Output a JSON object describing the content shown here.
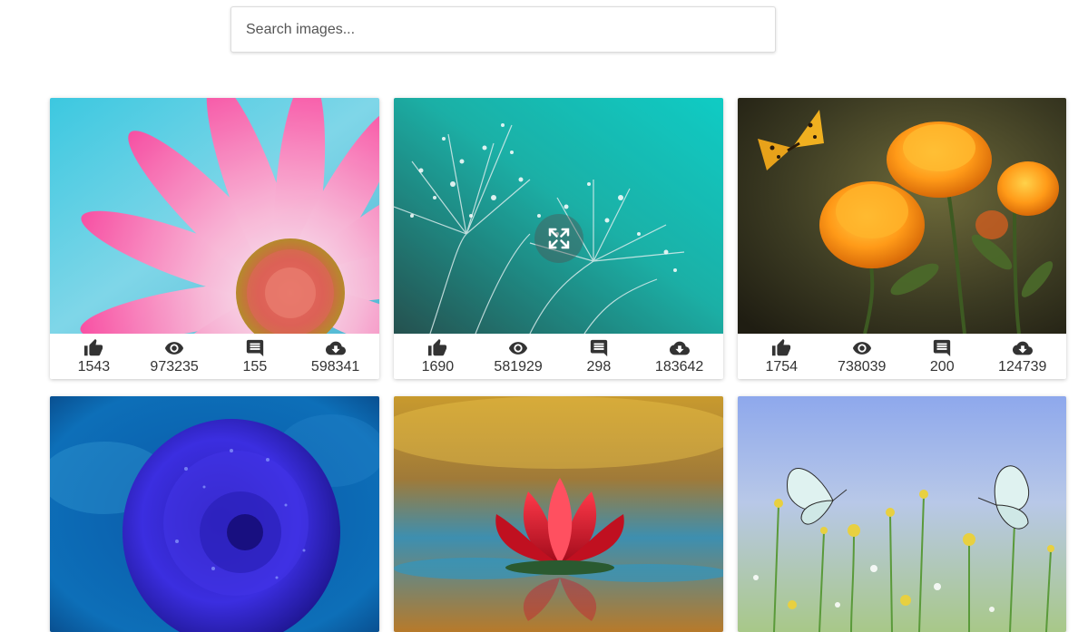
{
  "search": {
    "placeholder": "Search images..."
  },
  "images": [
    {
      "likes": "1543",
      "views": "973235",
      "comments": "155",
      "downloads": "598341"
    },
    {
      "likes": "1690",
      "views": "581929",
      "comments": "298",
      "downloads": "183642"
    },
    {
      "likes": "1754",
      "views": "738039",
      "comments": "200",
      "downloads": "124739"
    }
  ],
  "icons": {
    "likes": "thumbs-up-icon",
    "views": "eye-icon",
    "comments": "comment-icon",
    "downloads": "cloud-download-icon",
    "expand": "fullscreen-icon"
  }
}
